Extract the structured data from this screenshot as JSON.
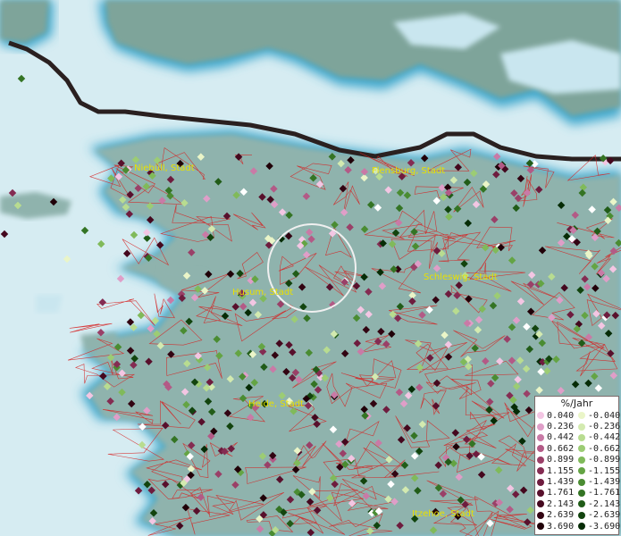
{
  "map": {
    "cities": [
      "Niebüll, Stadt",
      "Flensburg, Stadt",
      "Husum, Stadt",
      "Schleswig, Stadt",
      "Heide, Stadt",
      "Itzehoe, Stadt"
    ],
    "colors": {
      "sea": "#d6ecf2",
      "land": "#8fb3ad",
      "denmark": "#7ea49a",
      "coast_blue": "#3aa6cc",
      "border": "#2a2020",
      "district_lines": "#d62020",
      "city_label": "#e8e000"
    }
  },
  "legend": {
    "title": "%/Jahr",
    "positive": [
      {
        "value": "0.040",
        "color": "#f3c6e3"
      },
      {
        "value": "0.236",
        "color": "#df9ec8"
      },
      {
        "value": "0.442",
        "color": "#c97aa6"
      },
      {
        "value": "0.662",
        "color": "#b35a86"
      },
      {
        "value": "0.899",
        "color": "#9a4068"
      },
      {
        "value": "1.155",
        "color": "#842c52"
      },
      {
        "value": "1.439",
        "color": "#6e1c3e"
      },
      {
        "value": "1.761",
        "color": "#58102c"
      },
      {
        "value": "2.143",
        "color": "#44081e"
      },
      {
        "value": "2.639",
        "color": "#320412"
      },
      {
        "value": "3.690",
        "color": "#200008"
      }
    ],
    "negative": [
      {
        "value": "-0.040",
        "color": "#eaf5c8"
      },
      {
        "value": "-0.236",
        "color": "#d3eab0"
      },
      {
        "value": "-0.442",
        "color": "#b8dc90"
      },
      {
        "value": "-0.662",
        "color": "#9ccc74"
      },
      {
        "value": "-0.899",
        "color": "#80ba5a"
      },
      {
        "value": "-1.155",
        "color": "#64a444"
      },
      {
        "value": "-1.439",
        "color": "#4a8c32"
      },
      {
        "value": "-1.761",
        "color": "#347424"
      },
      {
        "value": "-2.143",
        "color": "#215c18"
      },
      {
        "value": "-2.639",
        "color": "#12440e"
      },
      {
        "value": "-3.690",
        "color": "#062c06"
      }
    ]
  }
}
